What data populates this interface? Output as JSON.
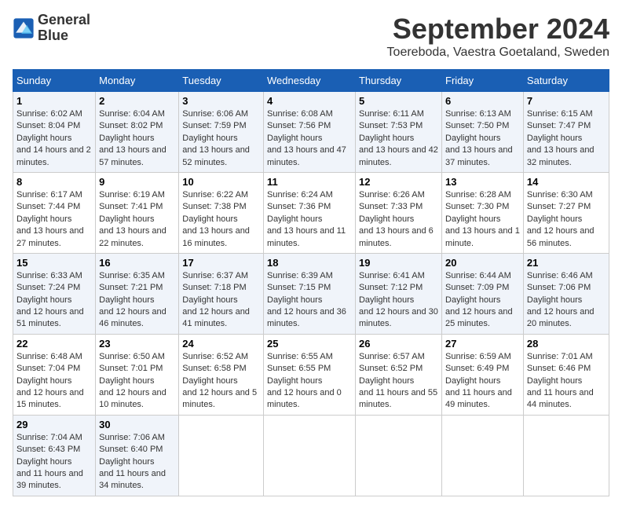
{
  "logo": {
    "line1": "General",
    "line2": "Blue"
  },
  "title": "September 2024",
  "subtitle": "Toereboda, Vaestra Goetaland, Sweden",
  "days_of_week": [
    "Sunday",
    "Monday",
    "Tuesday",
    "Wednesday",
    "Thursday",
    "Friday",
    "Saturday"
  ],
  "weeks": [
    [
      {
        "day": "1",
        "sunrise": "6:02 AM",
        "sunset": "8:04 PM",
        "daylight": "14 hours and 2 minutes."
      },
      {
        "day": "2",
        "sunrise": "6:04 AM",
        "sunset": "8:02 PM",
        "daylight": "13 hours and 57 minutes."
      },
      {
        "day": "3",
        "sunrise": "6:06 AM",
        "sunset": "7:59 PM",
        "daylight": "13 hours and 52 minutes."
      },
      {
        "day": "4",
        "sunrise": "6:08 AM",
        "sunset": "7:56 PM",
        "daylight": "13 hours and 47 minutes."
      },
      {
        "day": "5",
        "sunrise": "6:11 AM",
        "sunset": "7:53 PM",
        "daylight": "13 hours and 42 minutes."
      },
      {
        "day": "6",
        "sunrise": "6:13 AM",
        "sunset": "7:50 PM",
        "daylight": "13 hours and 37 minutes."
      },
      {
        "day": "7",
        "sunrise": "6:15 AM",
        "sunset": "7:47 PM",
        "daylight": "13 hours and 32 minutes."
      }
    ],
    [
      {
        "day": "8",
        "sunrise": "6:17 AM",
        "sunset": "7:44 PM",
        "daylight": "13 hours and 27 minutes."
      },
      {
        "day": "9",
        "sunrise": "6:19 AM",
        "sunset": "7:41 PM",
        "daylight": "13 hours and 22 minutes."
      },
      {
        "day": "10",
        "sunrise": "6:22 AM",
        "sunset": "7:38 PM",
        "daylight": "13 hours and 16 minutes."
      },
      {
        "day": "11",
        "sunrise": "6:24 AM",
        "sunset": "7:36 PM",
        "daylight": "13 hours and 11 minutes."
      },
      {
        "day": "12",
        "sunrise": "6:26 AM",
        "sunset": "7:33 PM",
        "daylight": "13 hours and 6 minutes."
      },
      {
        "day": "13",
        "sunrise": "6:28 AM",
        "sunset": "7:30 PM",
        "daylight": "13 hours and 1 minute."
      },
      {
        "day": "14",
        "sunrise": "6:30 AM",
        "sunset": "7:27 PM",
        "daylight": "12 hours and 56 minutes."
      }
    ],
    [
      {
        "day": "15",
        "sunrise": "6:33 AM",
        "sunset": "7:24 PM",
        "daylight": "12 hours and 51 minutes."
      },
      {
        "day": "16",
        "sunrise": "6:35 AM",
        "sunset": "7:21 PM",
        "daylight": "12 hours and 46 minutes."
      },
      {
        "day": "17",
        "sunrise": "6:37 AM",
        "sunset": "7:18 PM",
        "daylight": "12 hours and 41 minutes."
      },
      {
        "day": "18",
        "sunrise": "6:39 AM",
        "sunset": "7:15 PM",
        "daylight": "12 hours and 36 minutes."
      },
      {
        "day": "19",
        "sunrise": "6:41 AM",
        "sunset": "7:12 PM",
        "daylight": "12 hours and 30 minutes."
      },
      {
        "day": "20",
        "sunrise": "6:44 AM",
        "sunset": "7:09 PM",
        "daylight": "12 hours and 25 minutes."
      },
      {
        "day": "21",
        "sunrise": "6:46 AM",
        "sunset": "7:06 PM",
        "daylight": "12 hours and 20 minutes."
      }
    ],
    [
      {
        "day": "22",
        "sunrise": "6:48 AM",
        "sunset": "7:04 PM",
        "daylight": "12 hours and 15 minutes."
      },
      {
        "day": "23",
        "sunrise": "6:50 AM",
        "sunset": "7:01 PM",
        "daylight": "12 hours and 10 minutes."
      },
      {
        "day": "24",
        "sunrise": "6:52 AM",
        "sunset": "6:58 PM",
        "daylight": "12 hours and 5 minutes."
      },
      {
        "day": "25",
        "sunrise": "6:55 AM",
        "sunset": "6:55 PM",
        "daylight": "12 hours and 0 minutes."
      },
      {
        "day": "26",
        "sunrise": "6:57 AM",
        "sunset": "6:52 PM",
        "daylight": "11 hours and 55 minutes."
      },
      {
        "day": "27",
        "sunrise": "6:59 AM",
        "sunset": "6:49 PM",
        "daylight": "11 hours and 49 minutes."
      },
      {
        "day": "28",
        "sunrise": "7:01 AM",
        "sunset": "6:46 PM",
        "daylight": "11 hours and 44 minutes."
      }
    ],
    [
      {
        "day": "29",
        "sunrise": "7:04 AM",
        "sunset": "6:43 PM",
        "daylight": "11 hours and 39 minutes."
      },
      {
        "day": "30",
        "sunrise": "7:06 AM",
        "sunset": "6:40 PM",
        "daylight": "11 hours and 34 minutes."
      },
      null,
      null,
      null,
      null,
      null
    ]
  ]
}
